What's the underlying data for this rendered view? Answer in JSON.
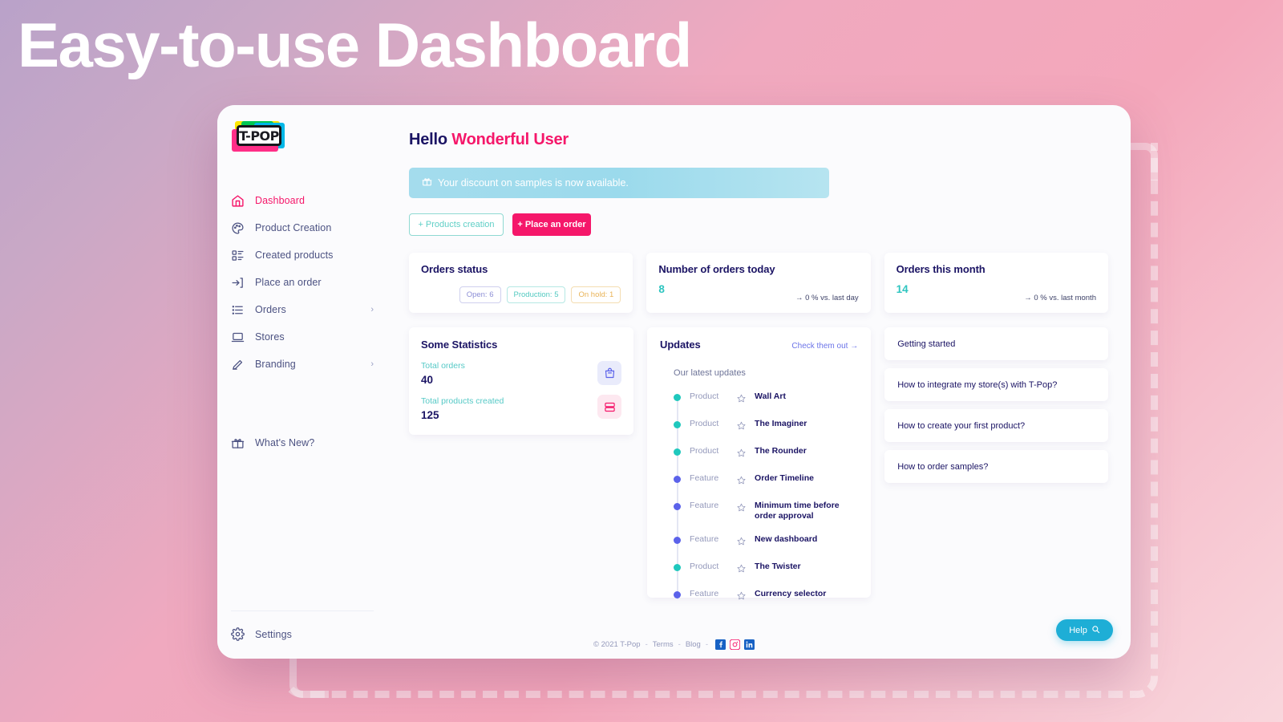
{
  "hero": {
    "title": "Easy-to-use Dashboard"
  },
  "brand": {
    "logo_text": "T-POP",
    "accent_pink": "#f5176a",
    "accent_navy": "#1b1464",
    "accent_teal": "#2ec5c0",
    "accent_blue": "#5b62ea"
  },
  "sidebar": {
    "items": [
      {
        "label": "Dashboard",
        "icon": "home-icon",
        "active": true,
        "chevron": ""
      },
      {
        "label": "Product Creation",
        "icon": "palette-icon",
        "active": false,
        "chevron": ""
      },
      {
        "label": "Created products",
        "icon": "list-details-icon",
        "active": false,
        "chevron": ""
      },
      {
        "label": "Place an order",
        "icon": "login-arrow-icon",
        "active": false,
        "chevron": ""
      },
      {
        "label": "Orders",
        "icon": "list-icon",
        "active": false,
        "chevron": "›"
      },
      {
        "label": "Stores",
        "icon": "laptop-icon",
        "active": false,
        "chevron": ""
      },
      {
        "label": "Branding",
        "icon": "pencil-icon",
        "active": false,
        "chevron": "›"
      }
    ],
    "whats_new": {
      "label": "What's New?",
      "icon": "gift-icon"
    },
    "settings": {
      "label": "Settings",
      "icon": "gear-icon"
    }
  },
  "header": {
    "greeting_hello": "Hello",
    "greeting_name": "Wonderful User"
  },
  "banner": {
    "icon": "gift-icon",
    "text": "Your discount on samples is now available."
  },
  "actions": {
    "products_creation": "+ Products creation",
    "place_an_order": "+ Place an order"
  },
  "cards": {
    "orders_status": {
      "title": "Orders status",
      "badges": [
        {
          "label": "Open: 6",
          "tone": "open"
        },
        {
          "label": "Production: 5",
          "tone": "prod"
        },
        {
          "label": "On hold: 1",
          "tone": "hold"
        }
      ]
    },
    "orders_today": {
      "title": "Number of orders today",
      "value": "8",
      "delta": "→ 0 % vs. last day"
    },
    "orders_month": {
      "title": "Orders this month",
      "value": "14",
      "delta": "→ 0 % vs. last month"
    },
    "some_statistics": {
      "title": "Some Statistics",
      "rows": [
        {
          "label": "Total orders",
          "value": "40",
          "icon": "shopping-bag-icon"
        },
        {
          "label": "Total products created",
          "value": "125",
          "icon": "stacked-cards-icon"
        }
      ]
    },
    "updates": {
      "title": "Updates",
      "link": "Check them out →",
      "subtitle": "Our latest updates",
      "items": [
        {
          "kind": "Product",
          "name": "Wall Art",
          "dot": "product"
        },
        {
          "kind": "Product",
          "name": "The Imaginer",
          "dot": "product"
        },
        {
          "kind": "Product",
          "name": "The Rounder",
          "dot": "product"
        },
        {
          "kind": "Feature",
          "name": "Order Timeline",
          "dot": "feature"
        },
        {
          "kind": "Feature",
          "name": "Minimum time before order approval",
          "dot": "feature"
        },
        {
          "kind": "Feature",
          "name": "New dashboard",
          "dot": "feature"
        },
        {
          "kind": "Product",
          "name": "The Twister",
          "dot": "product"
        },
        {
          "kind": "Feature",
          "name": "Currency selector",
          "dot": "feature"
        }
      ]
    },
    "help_links": [
      {
        "label": "Getting started"
      },
      {
        "label": "How to integrate my store(s) with T-Pop?"
      },
      {
        "label": "How to create your first product?"
      },
      {
        "label": "How to order samples?"
      }
    ]
  },
  "footer": {
    "copyright": "© 2021 T-Pop",
    "sep1": "-",
    "terms": "Terms",
    "sep2": "-",
    "blog": "Blog",
    "sep3": "-",
    "social": [
      "facebook-icon",
      "instagram-icon",
      "linkedin-icon"
    ]
  },
  "help_fab": {
    "label": "Help",
    "icon": "search-icon"
  }
}
